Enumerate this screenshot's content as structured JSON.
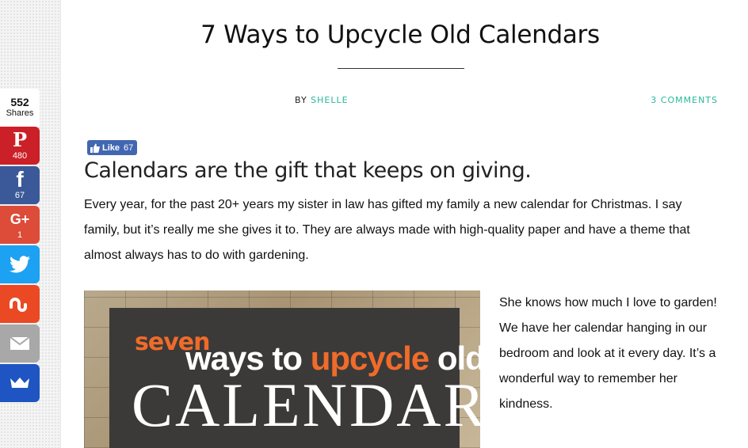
{
  "article": {
    "title": "7 Ways to Upcycle Old Calendars",
    "by_label": "BY",
    "author": "SHELLE",
    "comments": "3 COMMENTS",
    "subheading": "Calendars are the gift that keeps on giving.",
    "intro": "Every year, for the past 20+ years my sister in law has gifted my family a new calendar for Christmas. I say family, but it’s really me she gives it to. They are always made with  high-quality paper and have a theme that almost always has to do with gardening.",
    "side_text": "She knows how much I love to garden! We have her calendar hanging in our bedroom and look at it every day. It’s a wonderful way to remember her kindness."
  },
  "like_button": {
    "label": "Like",
    "count": "67"
  },
  "share_bar": {
    "total": "552",
    "total_label": "Shares",
    "buttons": [
      {
        "network": "pinterest",
        "icon": "pinterest-icon",
        "glyph": "P",
        "count": "480",
        "color": "#cb2027"
      },
      {
        "network": "facebook",
        "icon": "facebook-icon",
        "glyph": "f",
        "count": "67",
        "color": "#3b5998"
      },
      {
        "network": "google-plus",
        "icon": "google-plus-icon",
        "glyph": "G+",
        "count": "1",
        "color": "#dd4b39"
      },
      {
        "network": "twitter",
        "icon": "twitter-icon",
        "color": "#1da1f2"
      },
      {
        "network": "stumbleupon",
        "icon": "stumbleupon-icon",
        "color": "#eb4924"
      },
      {
        "network": "email",
        "icon": "envelope-icon",
        "color": "#a8a8a8"
      },
      {
        "network": "crown",
        "icon": "crown-icon",
        "color": "#1e55c2"
      }
    ]
  },
  "hero_image": {
    "line1": "seven",
    "line2_a": "ways to ",
    "line2_b": "upcycle",
    "line2_c": " old",
    "line3": "CALENDARS"
  },
  "colors": {
    "accent": "#28b89a",
    "hero_orange": "#f06b2a"
  }
}
